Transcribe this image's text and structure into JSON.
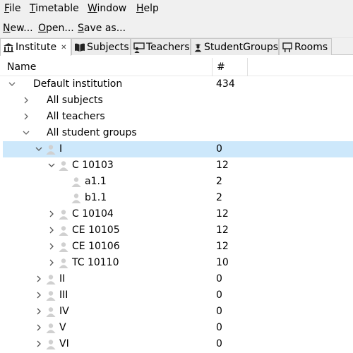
{
  "menu": {
    "file": {
      "ul": "F",
      "rest": "ile"
    },
    "timetable": {
      "ul": "T",
      "rest": "imetable"
    },
    "window": {
      "ul": "W",
      "rest": "indow"
    },
    "help": {
      "ul": "H",
      "rest": "elp"
    }
  },
  "toolbar": {
    "new": {
      "ul": "N",
      "rest": "ew..."
    },
    "open": {
      "ul": "O",
      "rest": "pen..."
    },
    "save": {
      "ul": "S",
      "rest": "ave as..."
    }
  },
  "tabs": [
    {
      "label": "Institute",
      "icon": "institute-icon",
      "active": true,
      "closable": true
    },
    {
      "label": "Subjects",
      "icon": "book-icon"
    },
    {
      "label": "Teachers",
      "icon": "teacher-icon"
    },
    {
      "label": "StudentGroups",
      "icon": "student-icon"
    },
    {
      "label": "Rooms",
      "icon": "room-icon"
    }
  ],
  "table": {
    "header_name": "Name",
    "header_count": "#",
    "rows": [
      {
        "label": "Default institution",
        "count": "434",
        "expanded": true
      },
      {
        "label": "All subjects",
        "count": "",
        "expanded": false
      },
      {
        "label": "All teachers",
        "count": "",
        "expanded": false
      },
      {
        "label": "All student groups",
        "count": "",
        "expanded": true
      },
      {
        "label": "I",
        "count": "0",
        "expanded": true,
        "selected": true
      },
      {
        "label": "C 10103",
        "count": "12",
        "expanded": true
      },
      {
        "label": "a1.1",
        "count": "2"
      },
      {
        "label": "b1.1",
        "count": "2"
      },
      {
        "label": "C 10104",
        "count": "12",
        "expanded": false
      },
      {
        "label": "CE 10105",
        "count": "12",
        "expanded": false
      },
      {
        "label": "CE 10106",
        "count": "12",
        "expanded": false
      },
      {
        "label": "TC 10110",
        "count": "10",
        "expanded": false
      },
      {
        "label": "II",
        "count": "0",
        "expanded": false
      },
      {
        "label": "III",
        "count": "0",
        "expanded": false
      },
      {
        "label": "IV",
        "count": "0",
        "expanded": false
      },
      {
        "label": "V",
        "count": "0",
        "expanded": false
      },
      {
        "label": "VI",
        "count": "0",
        "expanded": false
      }
    ]
  },
  "colors": {
    "selection": "#cde8fb",
    "chrome": "#f0f0f0",
    "person_icon": "#d0d0d0"
  }
}
